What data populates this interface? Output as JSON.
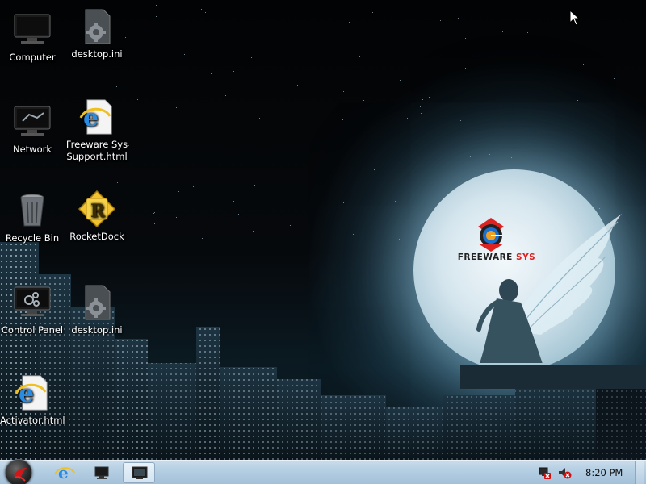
{
  "desktop": {
    "icons": [
      {
        "label": "Computer",
        "icon": "computer-icon"
      },
      {
        "label": "desktop.ini",
        "icon": "settings-file-icon"
      },
      {
        "label": "Network",
        "icon": "network-icon"
      },
      {
        "label": "Freeware Sys Support.html",
        "line1": "Freeware Sys",
        "line2": "Support.html",
        "icon": "html-file-icon"
      },
      {
        "label": "Recycle Bin",
        "icon": "recycle-bin-icon"
      },
      {
        "label": "RocketDock",
        "icon": "rocketdock-icon"
      },
      {
        "label": "Control Panel",
        "icon": "control-panel-icon"
      },
      {
        "label": "desktop.ini",
        "icon": "settings-file-icon"
      },
      {
        "label": "Activator.html",
        "icon": "html-file-icon"
      }
    ]
  },
  "wallpaper": {
    "brand_main": "FREEWARE",
    "brand_accent": "SYS",
    "accent_color": "#e02020"
  },
  "taskbar": {
    "start_icon": "start-orb-icon",
    "pinned": [
      {
        "name": "internet-explorer",
        "icon": "ie-icon"
      },
      {
        "name": "monitor",
        "icon": "monitor-icon"
      },
      {
        "name": "window",
        "icon": "window-icon",
        "active": true
      }
    ],
    "tray": {
      "icons": [
        "network-error-icon",
        "volume-muted-icon"
      ],
      "clock": "8:20 PM"
    }
  }
}
